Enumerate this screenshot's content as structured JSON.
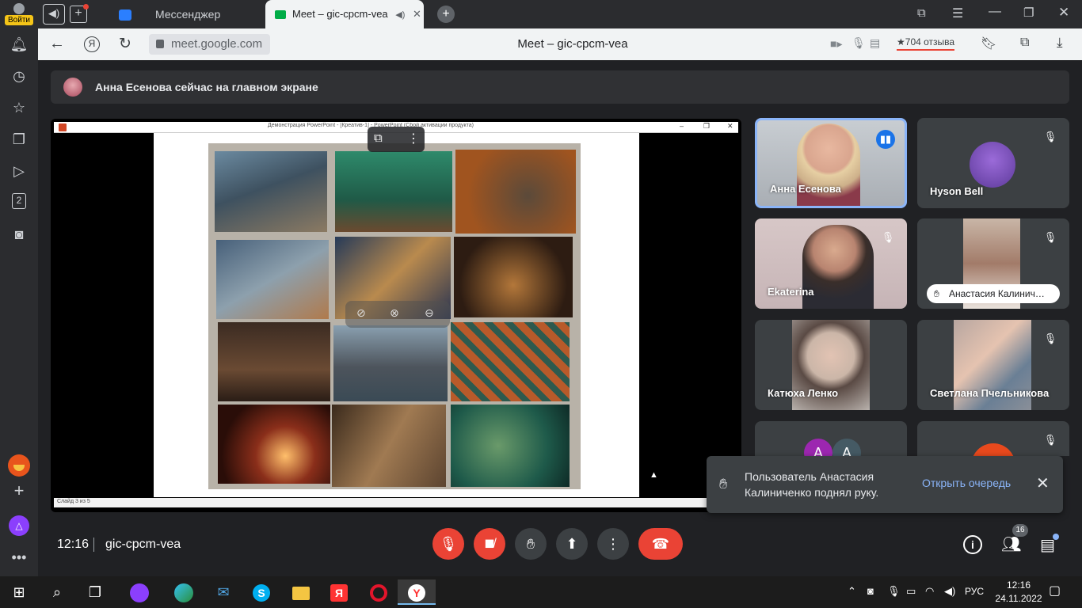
{
  "browser": {
    "login_label": "Войти",
    "sidebar_badge": "2",
    "tabs": [
      {
        "label": "Мессенджер"
      },
      {
        "label": "Meet – gic-cpcm-vea"
      }
    ],
    "url": "meet.google.com",
    "page_title": "Meet – gic-cpcm-vea",
    "reviews": "704 отзыва"
  },
  "meet": {
    "banner_text": "Анна Есенова сейчас на главном экране",
    "ppt_window_title": "Демонстрация PowerPoint - [Креатив-1] - PowerPoint (Сбой активации продукта)",
    "slide_status": "Слайд 3 из 5",
    "participants": [
      {
        "name": "Анна Есенова",
        "speaking": true
      },
      {
        "name": "Hyson Bell",
        "muted": true
      },
      {
        "name": "Ekaterina",
        "muted": true
      },
      {
        "name": "Анастасия Калинич…",
        "muted": true,
        "hand_raised": true
      },
      {
        "name": "Катюха Ленко",
        "muted": false
      },
      {
        "name": "Светлана Пчельникова",
        "muted": true
      }
    ],
    "extra_avatars": [
      "А",
      "А"
    ],
    "toast": {
      "text": "Пользователь Анастасия Калиниченко поднял руку.",
      "action": "Открыть очередь"
    },
    "time": "12:16",
    "meeting_code": "gic-cpcm-vea",
    "people_count": "16"
  },
  "taskbar": {
    "lang": "РУС",
    "time": "12:16",
    "date": "24.11.2022"
  },
  "colors": {
    "meet_bg": "#202124",
    "end_call_red": "#ea4335",
    "link_blue": "#8ab4f8",
    "speaker_border": "#8ab4f8"
  }
}
